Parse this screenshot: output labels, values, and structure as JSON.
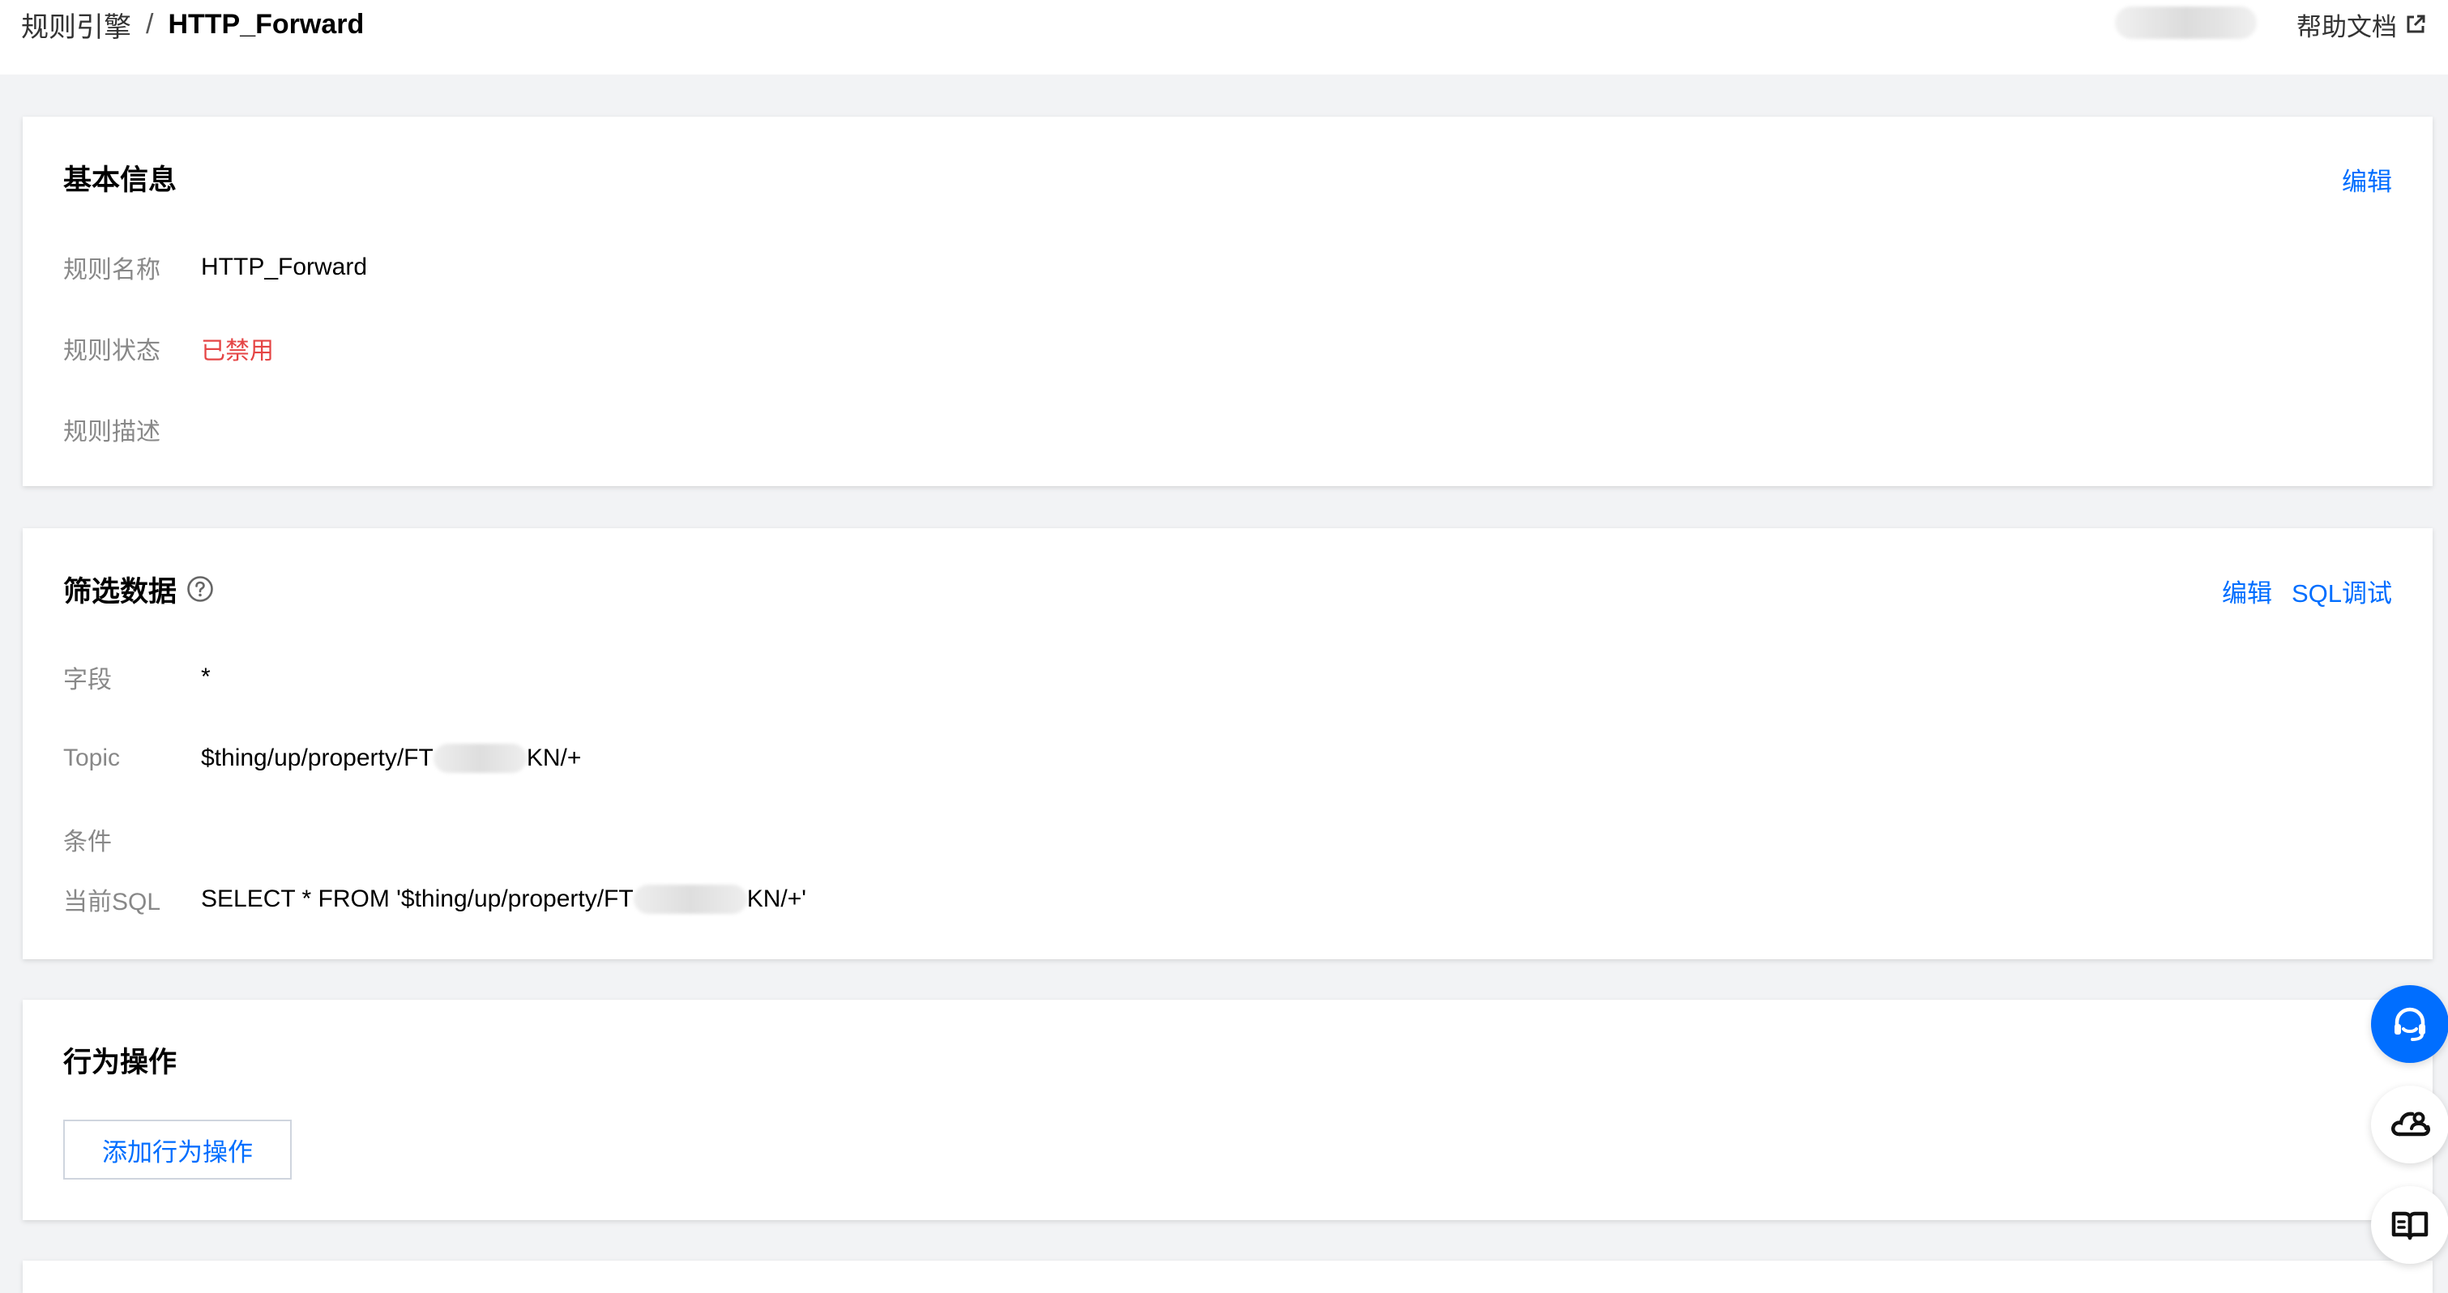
{
  "header": {
    "breadcrumb_parent": "规则引擎",
    "breadcrumb_separator": "/",
    "breadcrumb_current": "HTTP_Forward",
    "help_label": "帮助文档"
  },
  "basic_info": {
    "title": "基本信息",
    "edit_label": "编辑",
    "rows": [
      {
        "label": "规则名称",
        "value": "HTTP_Forward"
      },
      {
        "label": "规则状态",
        "value": "已禁用"
      },
      {
        "label": "规则描述",
        "value": ""
      }
    ]
  },
  "filter_data": {
    "title": "筛选数据",
    "edit_label": "编辑",
    "sql_debug_label": "SQL调试",
    "rows": [
      {
        "label": "字段",
        "value": "*"
      },
      {
        "label": "Topic",
        "value_prefix": "$thing/up/property/FT",
        "value_suffix": "KN/+"
      },
      {
        "label": "条件",
        "value": ""
      },
      {
        "label": "当前SQL",
        "value_prefix": "SELECT * FROM '$thing/up/property/FT",
        "value_suffix": "KN/+'"
      }
    ]
  },
  "actions": {
    "title": "行为操作",
    "add_button_label": "添加行为操作"
  },
  "floating_buttons": [
    {
      "icon": "headset-icon"
    },
    {
      "icon": "cloud-user-icon"
    },
    {
      "icon": "open-book-icon"
    }
  ],
  "colors": {
    "link": "#006eff",
    "status_disabled": "#e54545",
    "page_bg": "#f2f3f5"
  }
}
